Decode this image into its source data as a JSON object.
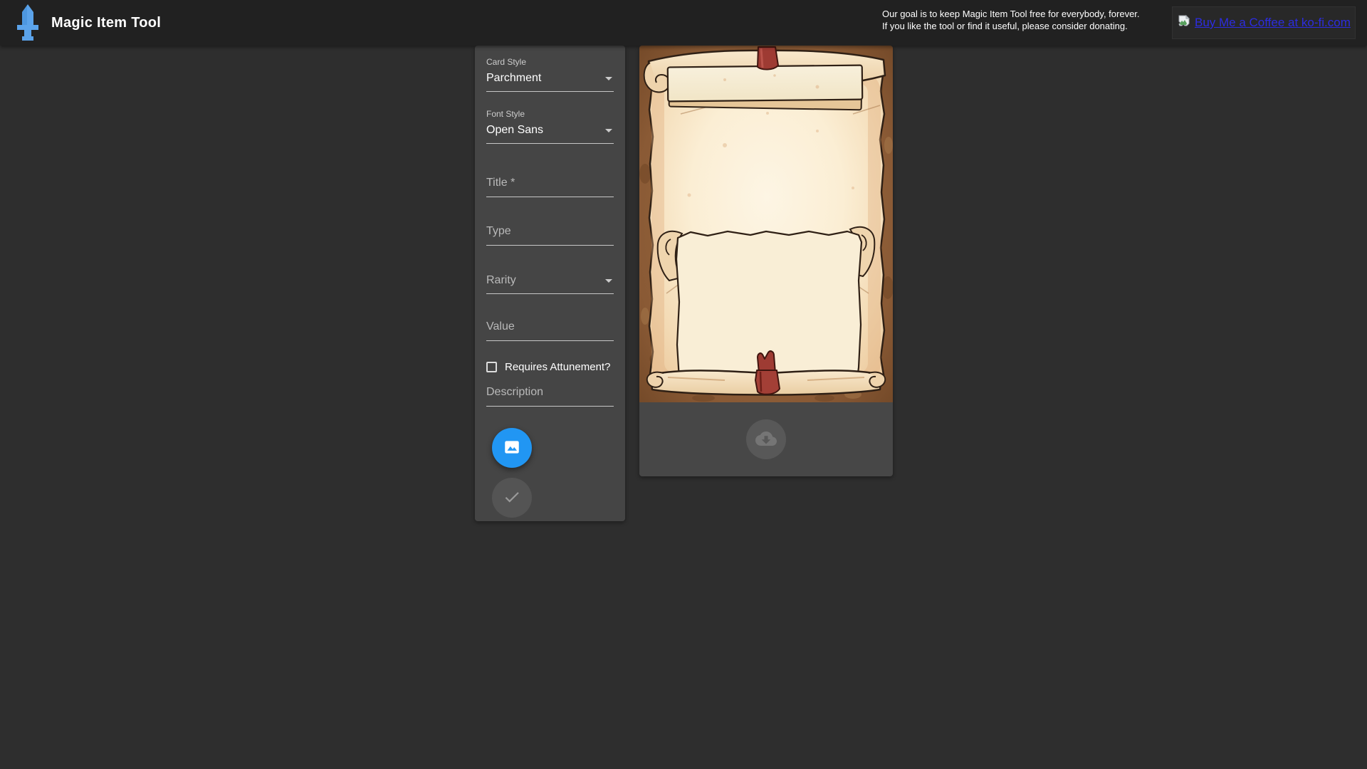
{
  "header": {
    "app_title": "Magic Item Tool",
    "donation": {
      "line1": "Our goal is to keep Magic Item Tool free for everybody, forever.",
      "line2": "If you like the tool or find it useful, please consider donating."
    },
    "kofi_link_text": "Buy Me a Coffee at ko-fi.com"
  },
  "form": {
    "card_style": {
      "label": "Card Style",
      "value": "Parchment"
    },
    "font_style": {
      "label": "Font Style",
      "value": "Open Sans"
    },
    "title": {
      "placeholder": "Title *",
      "value": ""
    },
    "type": {
      "placeholder": "Type",
      "value": ""
    },
    "rarity": {
      "placeholder": "Rarity",
      "value": ""
    },
    "value": {
      "placeholder": "Value",
      "value": ""
    },
    "attunement": {
      "label": "Requires Attunement?",
      "checked": false
    },
    "description": {
      "placeholder": "Description",
      "value": ""
    },
    "buttons": {
      "add_image": "image-icon",
      "submit": "check-icon (disabled)"
    }
  },
  "preview": {
    "card_style_shown": "Parchment (blank card)",
    "download_button": "cloud-download-icon"
  },
  "colors": {
    "header_bg": "#212121",
    "page_bg": "#2e2e2e",
    "panel_bg": "#454545",
    "accent_blue": "#2196f3",
    "logo_blue": "#5ba3ea",
    "link_blue": "#2c2ce0",
    "parchment_light": "#fdf5e4",
    "parchment_tan": "#edcda1",
    "border_brown": "#8a5a35",
    "ribbon_red": "#9e3b33"
  }
}
